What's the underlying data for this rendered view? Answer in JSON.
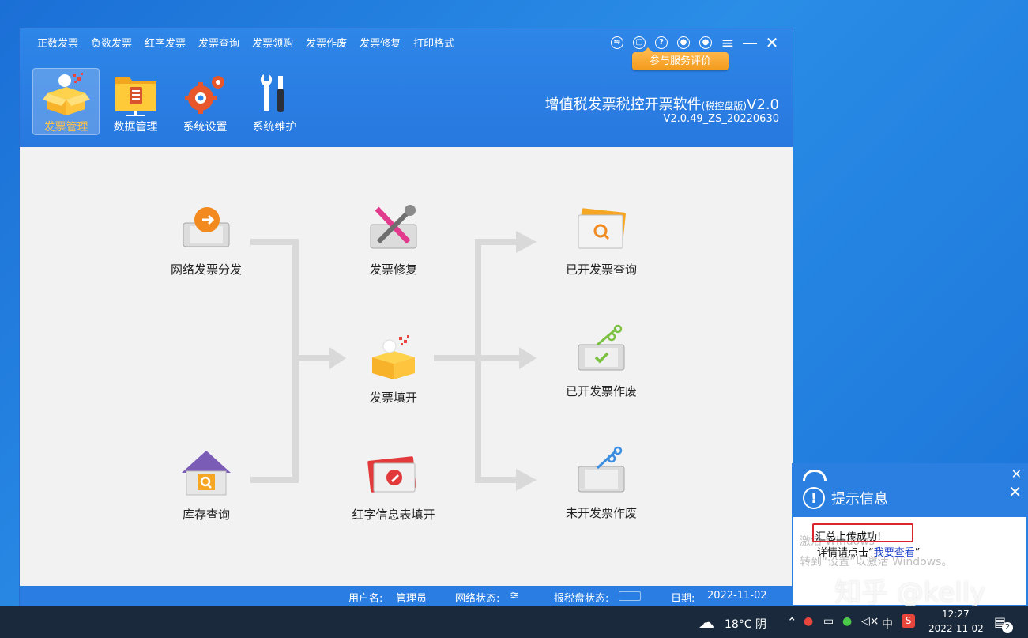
{
  "menu": [
    "正数发票",
    "负数发票",
    "红字发票",
    "发票查询",
    "发票领购",
    "发票作废",
    "发票修复",
    "打印格式"
  ],
  "rate_button": "参与服务评价",
  "modules": [
    {
      "label": "发票管理",
      "icon": "box-icon",
      "active": true
    },
    {
      "label": "数据管理",
      "icon": "folder-icon",
      "active": false
    },
    {
      "label": "系统设置",
      "icon": "gear-icon",
      "active": false
    },
    {
      "label": "系统维护",
      "icon": "tools-icon",
      "active": false
    }
  ],
  "app": {
    "title": "增值税发票税控开票软件",
    "title_suffix": "(税控盘版)",
    "version_tag": "V2.0",
    "build": "V2.0.49_ZS_20220630"
  },
  "flow": {
    "dispatch": "网络发票分发",
    "inventory": "库存查询",
    "repair": "发票修复",
    "fill": "发票填开",
    "red_fill": "红字信息表填开",
    "issued_query": "已开发票查询",
    "issued_void": "已开发票作废",
    "unissued_void": "未开发票作废"
  },
  "status": {
    "user_label": "用户名:",
    "user": "管理员",
    "net_label": "网络状态:",
    "disk_label": "报税盘状态:",
    "date_label": "日期:",
    "date": "2022-11-02"
  },
  "notification": {
    "title": "提示信息",
    "message": "汇总上传成功!",
    "detail_prefix": "详情请点击“",
    "detail_link": "我要查看",
    "detail_suffix": "”",
    "ghost_1": "激活 Windows",
    "ghost_2": "转到“设置”以激活 Windows。"
  },
  "watermark": "知乎 @kelly",
  "taskbar": {
    "weather": "18°C 阴",
    "ime": "中",
    "time": "12:27",
    "date": "2022-11-02",
    "notif_count": "2"
  },
  "colors": {
    "header_blue": "#2e86e8",
    "accent_orange": "#f29a1c",
    "arrow_gray": "#d9d9d9",
    "alert_red": "#d8262c"
  }
}
